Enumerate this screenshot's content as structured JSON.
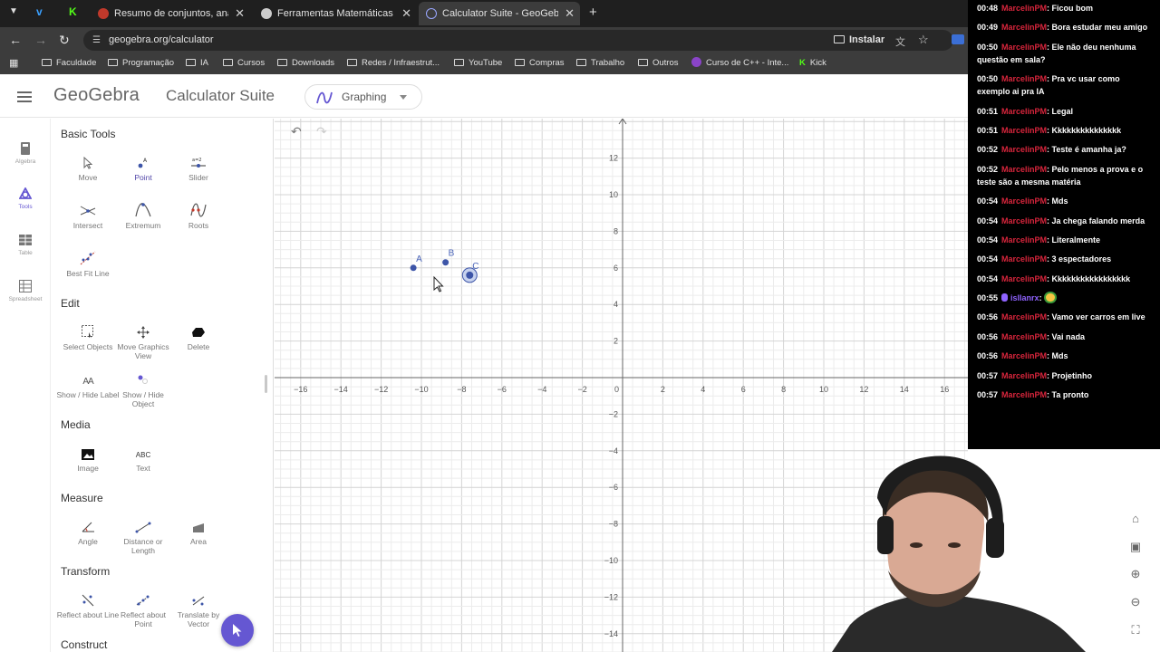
{
  "browser": {
    "tabs": [
      {
        "title": "Resumo de conjuntos, análise c"
      },
      {
        "title": "Ferramentas Matemáticas Nave"
      },
      {
        "title": "Calculator Suite - GeoGebra"
      }
    ],
    "url": "geogebra.org/calculator",
    "install_label": "Instalar",
    "bookmarks": [
      "Faculdade",
      "Programação",
      "IA",
      "Cursos",
      "Downloads",
      "Redes / Infraestrut...",
      "YouTube",
      "Compras",
      "Trabalho",
      "Outros",
      "Curso de C++ - Inte...",
      "Kick"
    ]
  },
  "app": {
    "logo": "GeoGebra",
    "suite": "Calculator Suite",
    "app_select": "Graphing"
  },
  "rail": [
    {
      "label": "Algebra"
    },
    {
      "label": "Tools"
    },
    {
      "label": "Table"
    },
    {
      "label": "Spreadsheet"
    }
  ],
  "tools": {
    "sections": [
      "Basic Tools",
      "Edit",
      "Media",
      "Measure",
      "Transform",
      "Construct"
    ],
    "basic": [
      "Move",
      "Point",
      "Slider",
      "Intersect",
      "Extremum",
      "Roots",
      "Best Fit Line"
    ],
    "slider_icon_text": "a=2",
    "edit": [
      "Select Objects",
      "Move Graphics View",
      "Delete",
      "Show / Hide Label",
      "Show / Hide Object"
    ],
    "showhide_label_icon_text": "AA",
    "media": [
      "Image",
      "Text"
    ],
    "text_icon_text": "ABC",
    "measure": [
      "Angle",
      "Distance or Length",
      "Area"
    ],
    "transform": [
      "Reflect about Line",
      "Reflect about Point",
      "Translate by Vector"
    ]
  },
  "graph": {
    "x_ticks": [
      -16,
      -14,
      -12,
      -10,
      -8,
      -6,
      -4,
      -2,
      0,
      2,
      4,
      6,
      8,
      10,
      12,
      14,
      16
    ],
    "y_ticks": [
      12,
      10,
      8,
      6,
      4,
      2,
      -2,
      -4,
      -6,
      -8,
      -10,
      -12,
      -14
    ],
    "points": [
      {
        "name": "A",
        "x": -10.4,
        "y": 6
      },
      {
        "name": "B",
        "x": -8.8,
        "y": 6.3
      },
      {
        "name": "C",
        "x": -7.6,
        "y": 5.6
      }
    ]
  },
  "chat": [
    {
      "time": "00:48",
      "user": "MarcelinPM",
      "text": "Ficou bom"
    },
    {
      "time": "00:49",
      "user": "MarcelinPM",
      "text": "Bora estudar meu amigo"
    },
    {
      "time": "00:50",
      "user": "MarcelinPM",
      "text": "Ele não deu nenhuma questão em sala?"
    },
    {
      "time": "00:50",
      "user": "MarcelinPM",
      "text": "Pra vc usar como exemplo ai pra IA"
    },
    {
      "time": "00:51",
      "user": "MarcelinPM",
      "text": "Legal"
    },
    {
      "time": "00:51",
      "user": "MarcelinPM",
      "text": "Kkkkkkkkkkkkkkk"
    },
    {
      "time": "00:52",
      "user": "MarcelinPM",
      "text": "Teste é amanha ja?"
    },
    {
      "time": "00:52",
      "user": "MarcelinPM",
      "text": "Pelo menos a prova e o teste são a mesma matéria"
    },
    {
      "time": "00:54",
      "user": "MarcelinPM",
      "text": "Mds"
    },
    {
      "time": "00:54",
      "user": "MarcelinPM",
      "text": "Ja chega falando merda"
    },
    {
      "time": "00:54",
      "user": "MarcelinPM",
      "text": "Literalmente"
    },
    {
      "time": "00:54",
      "user": "MarcelinPM",
      "text": "3 espectadores"
    },
    {
      "time": "00:54",
      "user": "MarcelinPM",
      "text": "Kkkkkkkkkkkkkkkkk"
    },
    {
      "time": "00:55",
      "user": "isllanrx",
      "text": "",
      "emote": true
    },
    {
      "time": "00:56",
      "user": "MarcelinPM",
      "text": "Vamo ver carros em live"
    },
    {
      "time": "00:56",
      "user": "MarcelinPM",
      "text": "Vai nada"
    },
    {
      "time": "00:56",
      "user": "MarcelinPM",
      "text": "Mds"
    },
    {
      "time": "00:57",
      "user": "MarcelinPM",
      "text": "Projetinho"
    },
    {
      "time": "00:57",
      "user": "MarcelinPM",
      "text": "Ta pronto"
    }
  ]
}
